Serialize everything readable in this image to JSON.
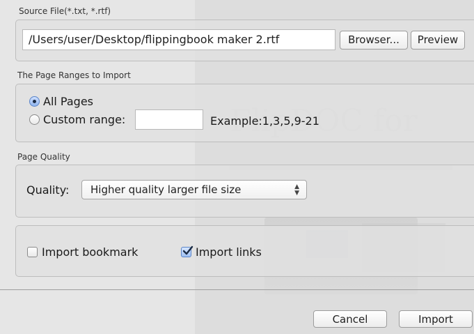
{
  "source": {
    "group_label": "Source File(*.txt, *.rtf)",
    "path_value": "/Users/user/Desktop/flippingbook maker 2.rtf",
    "browse_label": "Browser...",
    "preview_label": "Preview"
  },
  "ranges": {
    "group_label": "The Page Ranges to Import",
    "all_pages_label": "All Pages",
    "all_pages_selected": true,
    "custom_label": "Custom range:",
    "custom_value": "",
    "example_text": "Example:1,3,5,9-21"
  },
  "quality": {
    "group_label": "Page Quality",
    "quality_label": "Quality:",
    "selected": "Higher quality larger file size"
  },
  "options": {
    "bookmark_label": "Import bookmark",
    "bookmark_checked": false,
    "links_label": "Import links",
    "links_checked": true
  },
  "footer": {
    "cancel_label": "Cancel",
    "import_label": "Import"
  },
  "background": {
    "ghost_title": "FlipDOC for"
  },
  "colors": {
    "accent": "#5a84c8",
    "dialog_bg": "#e6e6e6"
  }
}
